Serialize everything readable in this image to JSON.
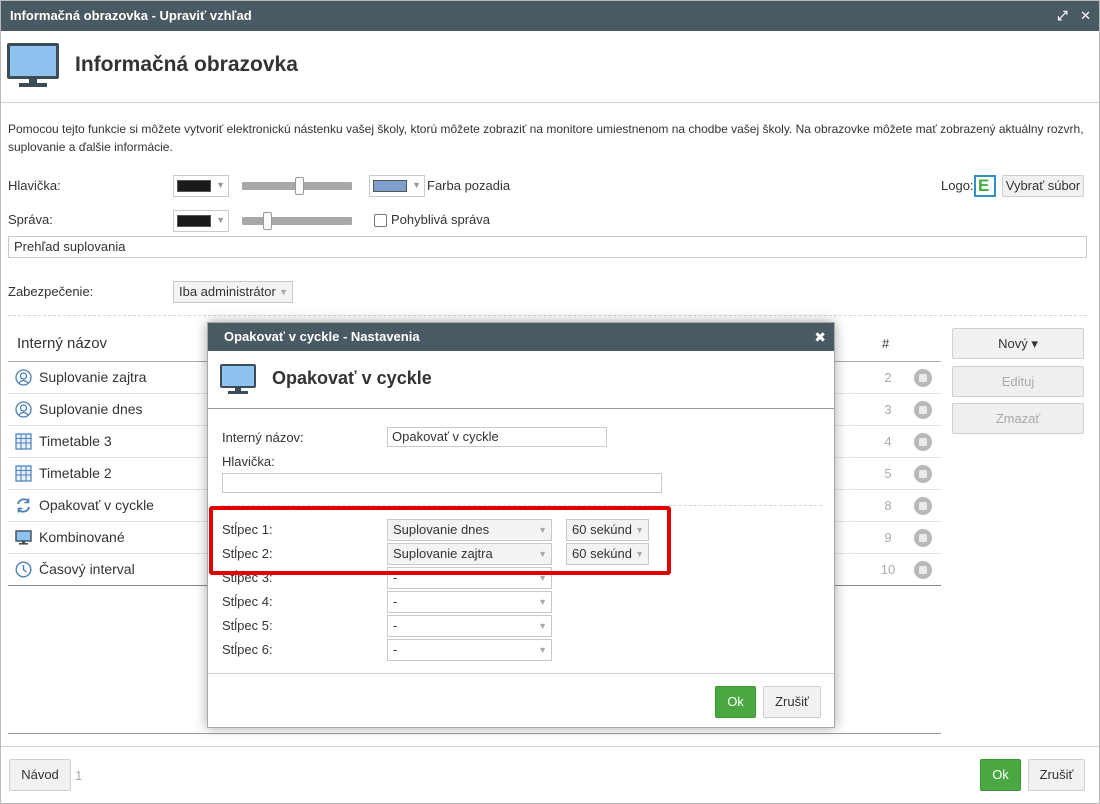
{
  "window": {
    "title": "Informačná obrazovka - Upraviť vzhľad",
    "maximize_icon": "⤢",
    "close_icon": "✕"
  },
  "header": {
    "title": "Informačná obrazovka"
  },
  "intro": "Pomocou tejto funkcie si môžete vytvoriť elektronickú nástenku vašej školy, ktorú môžete zobraziť na monitore umiestnenom na chodbe vašej školy. Na obrazovke môžete mať zobrazený aktuálny rozvrh, suplovanie a ďalšie informácie.",
  "settings": {
    "header_label": "Hlavička:",
    "header_color": "#1a1a1a",
    "bg_color": "#7f9fcf",
    "bg_color_label": "Farba pozadia",
    "logo_label": "Logo:",
    "select_file_button": "Vybrať súbor",
    "message_label": "Správa:",
    "message_color": "#1a1a1a",
    "moving_message_label": "Pohyblivá správa",
    "message_value": "Prehľad suplovania",
    "security_label": "Zabezpečenie:",
    "security_value": "Iba administrátor"
  },
  "list": {
    "col_name": "Interný názov",
    "col_num": "#",
    "rows": [
      {
        "icon": "substitution-icon",
        "name": "Suplovanie zajtra",
        "num": "2"
      },
      {
        "icon": "substitution-icon",
        "name": "Suplovanie dnes",
        "num": "3"
      },
      {
        "icon": "timetable-icon",
        "name": "Timetable 3",
        "num": "4"
      },
      {
        "icon": "timetable-icon",
        "name": "Timetable 2",
        "num": "5"
      },
      {
        "icon": "cycle-icon",
        "name": "Opakovať v cyckle",
        "num": "8"
      },
      {
        "icon": "monitor-icon",
        "name": "Kombinované",
        "num": "9"
      },
      {
        "icon": "clock-icon",
        "name": "Časový interval",
        "num": "10"
      }
    ]
  },
  "side_buttons": {
    "new": "Nový ▾",
    "edit": "Edituj",
    "delete": "Zmazať"
  },
  "footer": {
    "help": "Návod",
    "page": "1",
    "ok": "Ok",
    "cancel": "Zrušiť"
  },
  "modal": {
    "title": "Opakovať v cyckle - Nastavenia",
    "close": "✖",
    "heading": "Opakovať v cyckle",
    "internal_name_label": "Interný názov:",
    "internal_name_value": "Opakovať v cyckle",
    "header_label": "Hlavička:",
    "header_value": "",
    "columns": [
      {
        "label": "Stĺpec 1:",
        "value": "Suplovanie dnes",
        "time": "60 sekúnd"
      },
      {
        "label": "Stĺpec 2:",
        "value": "Suplovanie zajtra",
        "time": "60 sekúnd"
      },
      {
        "label": "Stĺpec 3:",
        "value": "-",
        "time": null
      },
      {
        "label": "Stĺpec 4:",
        "value": "-",
        "time": null
      },
      {
        "label": "Stĺpec 5:",
        "value": "-",
        "time": null
      },
      {
        "label": "Stĺpec 6:",
        "value": "-",
        "time": null
      }
    ],
    "ok": "Ok",
    "cancel": "Zrušiť"
  },
  "highlight_color": "#e00000"
}
